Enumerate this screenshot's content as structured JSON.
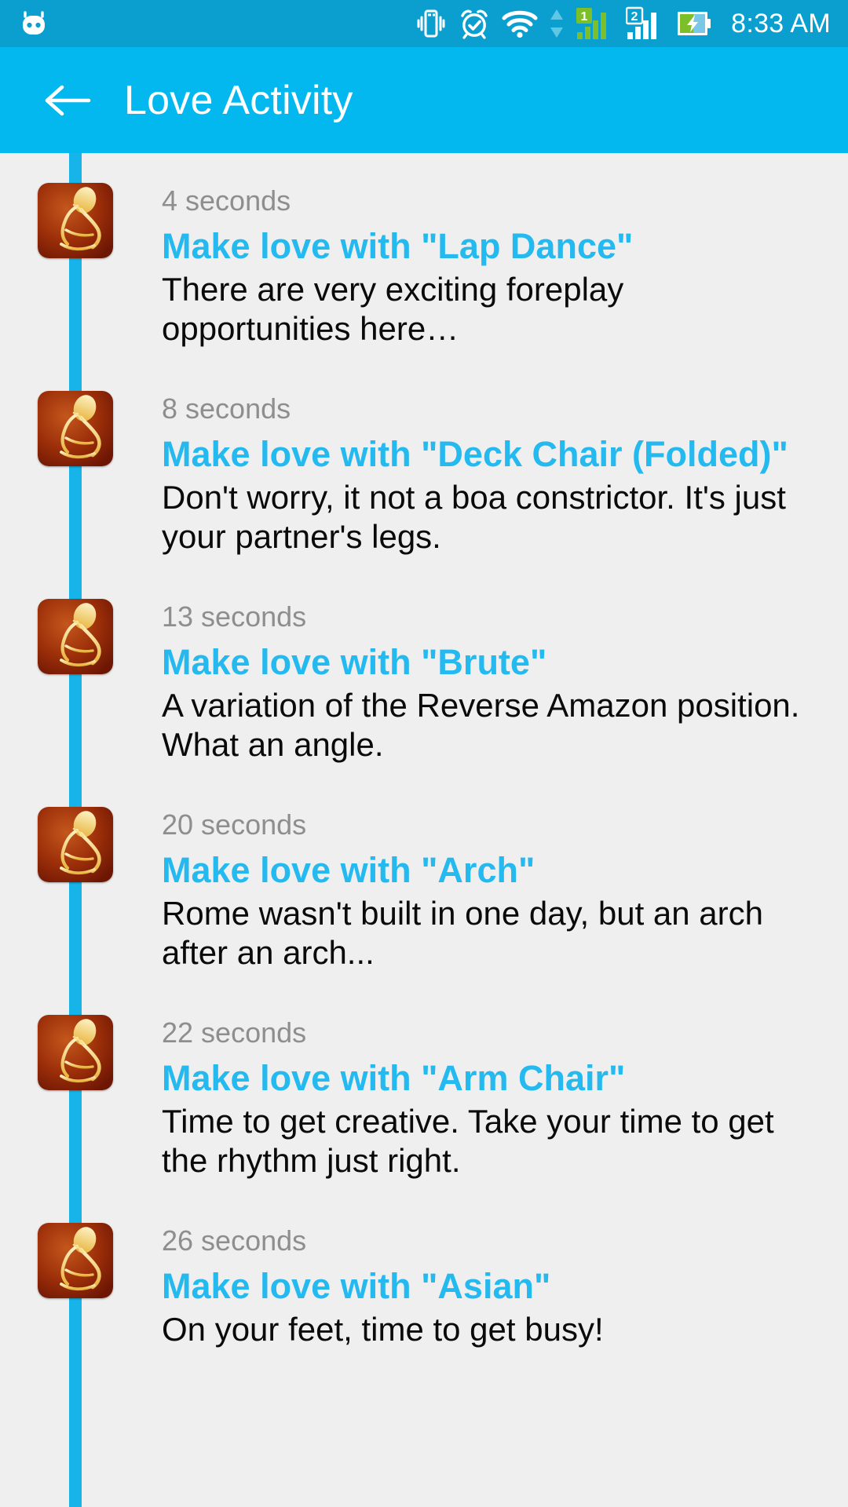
{
  "status_bar": {
    "background_color": "#0b9fd0",
    "left_icons": [
      {
        "name": "cyanogenmod-logo-icon",
        "label": "CyanogenMod"
      }
    ],
    "right_icons": [
      {
        "name": "vibrate-icon",
        "label": "Vibrate mode"
      },
      {
        "name": "alarm-clock-icon",
        "label": "Alarm set"
      },
      {
        "name": "wifi-icon",
        "label": "Wi-Fi connected"
      },
      {
        "name": "data-transfer-arrows-icon",
        "label": "Data up/down"
      },
      {
        "name": "signal-sim1-icon",
        "label": "SIM 1 signal",
        "sim": "1"
      },
      {
        "name": "signal-sim2-icon",
        "label": "SIM 2 signal",
        "sim": "2"
      },
      {
        "name": "battery-charging-icon",
        "label": "Battery charging"
      }
    ],
    "clock": "8:33 AM"
  },
  "app_bar": {
    "background_color": "#03b8ef",
    "back_label": "Back",
    "title": "Love Activity"
  },
  "timeline": {
    "line_color": "#16b4e8",
    "time_color": "#8e8e8e",
    "title_color": "#24b9ef",
    "desc_color": "#0a0a0a",
    "thumb_colors": {
      "outer": "#7d1d06",
      "inner": "#c2531a",
      "figure": "#f5d77a"
    },
    "entries": [
      {
        "time": "4 seconds",
        "title": "Make love with \"Lap Dance\"",
        "description": "There are very exciting foreplay opportunities here…",
        "thumb_name": "love-position-thumbnail"
      },
      {
        "time": "8 seconds",
        "title": "Make love with \"Deck Chair (Folded)\"",
        "description": "Don't worry, it not a boa constrictor. It's just your partner's legs.",
        "thumb_name": "love-position-thumbnail"
      },
      {
        "time": "13 seconds",
        "title": "Make love with \"Brute\"",
        "description": "A variation of the Reverse Amazon position. What an angle.",
        "thumb_name": "love-position-thumbnail"
      },
      {
        "time": "20 seconds",
        "title": "Make love with \"Arch\"",
        "description": "Rome wasn't built in one day, but an arch after an arch...",
        "thumb_name": "love-position-thumbnail"
      },
      {
        "time": "22 seconds",
        "title": "Make love with \"Arm Chair\"",
        "description": "Time to get creative. Take your time to get the rhythm just right.",
        "thumb_name": "love-position-thumbnail"
      },
      {
        "time": "26 seconds",
        "title": "Make love with \"Asian\"",
        "description": "On your feet, time to get busy!",
        "thumb_name": "love-position-thumbnail"
      }
    ]
  }
}
